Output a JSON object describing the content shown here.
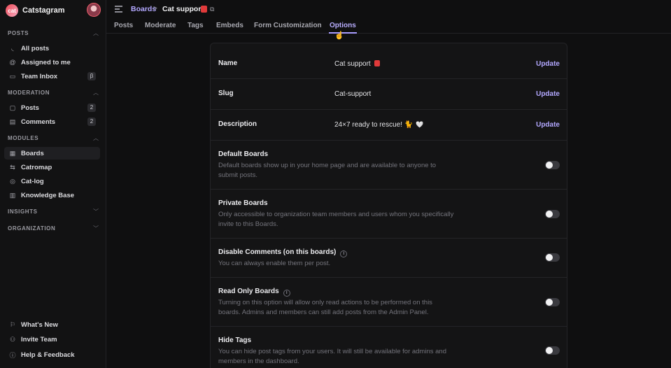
{
  "app": {
    "name": "Catstagram",
    "logo_text": "cat"
  },
  "sidebar": {
    "sections": {
      "posts": "POSTS",
      "moderation": "MODERATION",
      "modules": "MODULES",
      "insights": "INSIGHTS",
      "organization": "ORGANIZATION"
    },
    "posts_items": [
      {
        "label": "All posts",
        "icon": "rss-icon"
      },
      {
        "label": "Assigned to me",
        "icon": "at-icon"
      },
      {
        "label": "Team Inbox",
        "icon": "inbox-icon",
        "badge": "β"
      }
    ],
    "moderation_items": [
      {
        "label": "Posts",
        "icon": "post-icon",
        "badge": "2"
      },
      {
        "label": "Comments",
        "icon": "comment-icon",
        "badge": "2"
      }
    ],
    "modules_items": [
      {
        "label": "Boards",
        "icon": "boards-icon"
      },
      {
        "label": "Catromap",
        "icon": "roadmap-icon"
      },
      {
        "label": "Cat-log",
        "icon": "changelog-icon"
      },
      {
        "label": "Knowledge Base",
        "icon": "book-icon"
      }
    ],
    "footer_items": [
      {
        "label": "What's New",
        "icon": "megaphone-icon"
      },
      {
        "label": "Invite Team",
        "icon": "user-plus-icon"
      },
      {
        "label": "Help & Feedback",
        "icon": "help-icon"
      }
    ]
  },
  "header": {
    "breadcrumb_root": "Boards",
    "breadcrumb_sep": ">",
    "board_name": "Cat support"
  },
  "tabs": [
    "Posts",
    "Moderate",
    "Tags",
    "Embeds",
    "Form Customization",
    "Options"
  ],
  "active_tab": "Options",
  "options": {
    "name": {
      "label": "Name",
      "value": "Cat support",
      "action": "Update"
    },
    "slug": {
      "label": "Slug",
      "value": "Cat-support",
      "action": "Update"
    },
    "description": {
      "label": "Description",
      "value": "24×7 ready to rescue! 🐈",
      "heart": "🤍",
      "action": "Update"
    },
    "default_boards": {
      "label": "Default Boards",
      "desc": "Default boards show up in your home page and are available to anyone to submit posts.",
      "enabled": false
    },
    "private_boards": {
      "label": "Private Boards",
      "desc": "Only accessible to organization team members and users whom you specifically invite to this Boards.",
      "enabled": false
    },
    "disable_comments": {
      "label": "Disable Comments (on this boards)",
      "desc": "You can always enable them per post.",
      "enabled": false
    },
    "read_only": {
      "label": "Read Only Boards",
      "desc": "Turning on this option will allow only read actions to be performed on this boards. Admins and members can still add posts from the Admin Panel.",
      "enabled": false
    },
    "hide_tags": {
      "label": "Hide Tags",
      "desc": "You can hide post tags from your users. It will still be available for admins and members in the dashboard.",
      "enabled": false
    }
  },
  "colors": {
    "accent": "#b3a8ff",
    "background": "#0f0f10",
    "panel": "#141415"
  }
}
